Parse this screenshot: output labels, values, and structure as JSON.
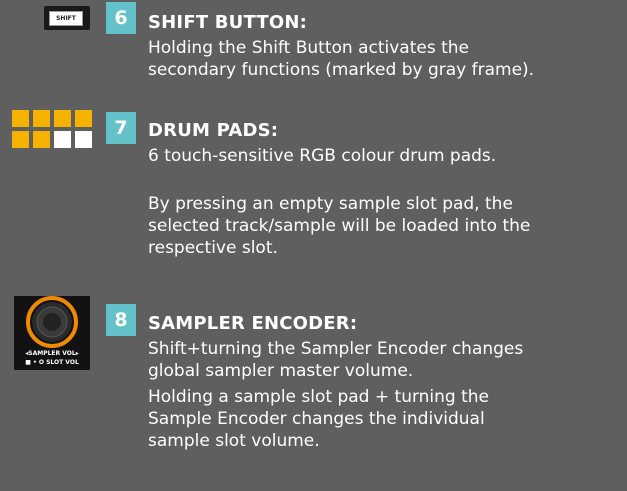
{
  "items": [
    {
      "number": "6",
      "heading": "SHIFT BUTTON:",
      "paragraphs": [
        "Holding the Shift Button activates the\nsecondary functions (marked by gray frame)."
      ],
      "thumbnail_label": "SHIFT"
    },
    {
      "number": "7",
      "heading": "DRUM PADS:",
      "paragraphs": [
        "6 touch-sensitive RGB colour drum pads.",
        "By pressing an empty sample slot pad, the\nselected track/sample will be loaded into the\nrespective slot."
      ],
      "pad_colors": [
        "#f5b300",
        "#f5b300",
        "#f5b300",
        "#f5b300",
        "#f5b300",
        "#f5b300",
        "#ffffff",
        "#ffffff"
      ]
    },
    {
      "number": "8",
      "heading": "SAMPLER ENCODER:",
      "paragraphs": [
        "Shift+turning the Sampler Encoder changes\nglobal sampler master volume.",
        "Holding a sample slot pad + turning the\nSample Encoder changes the individual\nsample slot volume."
      ],
      "thumbnail_label_top": "◂SAMPLER VOL▸",
      "thumbnail_label_bottom": "■ • O SLOT VOL",
      "ring_color": "#f08a00"
    }
  ],
  "colors": {
    "background": "#5f5f5f",
    "badge": "#63c2c9",
    "text": "#ffffff"
  }
}
